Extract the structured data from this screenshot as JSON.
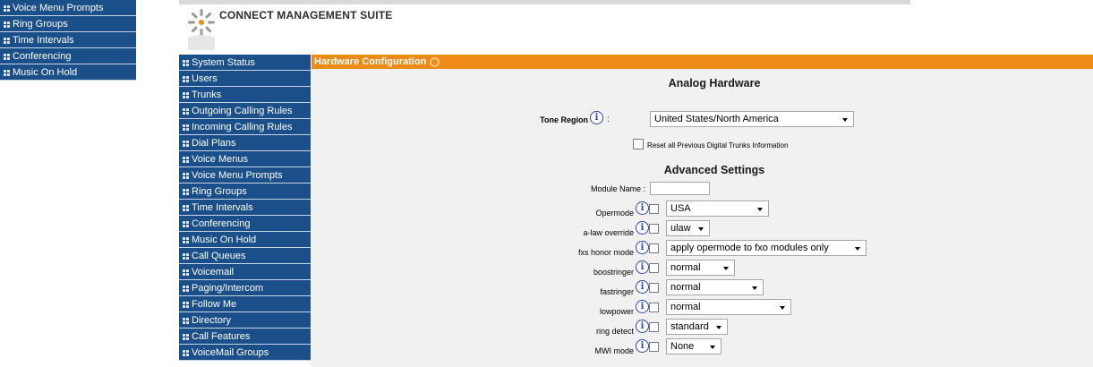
{
  "ghost_nav": [
    "Voice Menu Prompts",
    "Ring Groups",
    "Time Intervals",
    "Conferencing",
    "Music On Hold"
  ],
  "app_title": "CONNECT MANAGEMENT SUITE",
  "sidebar": [
    "System Status",
    "Users",
    "Trunks",
    "Outgoing Calling Rules",
    "Incoming Calling Rules",
    "Dial Plans",
    "Voice Menus",
    "Voice Menu Prompts",
    "Ring Groups",
    "Time Intervals",
    "Conferencing",
    "Music On Hold",
    "Call Queues",
    "Voicemail",
    "Paging/Intercom",
    "Follow Me",
    "Directory",
    "Call Features",
    "VoiceMail Groups"
  ],
  "section_title": "Hardware Configuration",
  "analog": {
    "heading": "Analog Hardware",
    "tone_region_label": "Tone Region",
    "tone_region_value": "United States/North America",
    "reset_label": "Reset all Previous Digital Trunks Information"
  },
  "advanced": {
    "heading": "Advanced Settings",
    "module_name_label": "Module Name :",
    "module_name_value": "",
    "colon": ":",
    "info_glyph": "i",
    "settings": [
      {
        "label": "Opermode",
        "value": "USA"
      },
      {
        "label": "a-law override",
        "value": "ulaw"
      },
      {
        "label": "fxs honor mode",
        "value": "apply opermode to fxo modules only"
      },
      {
        "label": "boostringer",
        "value": "normal"
      },
      {
        "label": "fastringer",
        "value": "normal"
      },
      {
        "label": "lowpower",
        "value": "normal"
      },
      {
        "label": "ring detect",
        "value": "standard"
      },
      {
        "label": "MWI mode",
        "value": "None"
      }
    ]
  },
  "colors": {
    "nav": "#1b4f8a",
    "section_bar": "#ee8a18",
    "content_bg": "#f1f1f1"
  }
}
